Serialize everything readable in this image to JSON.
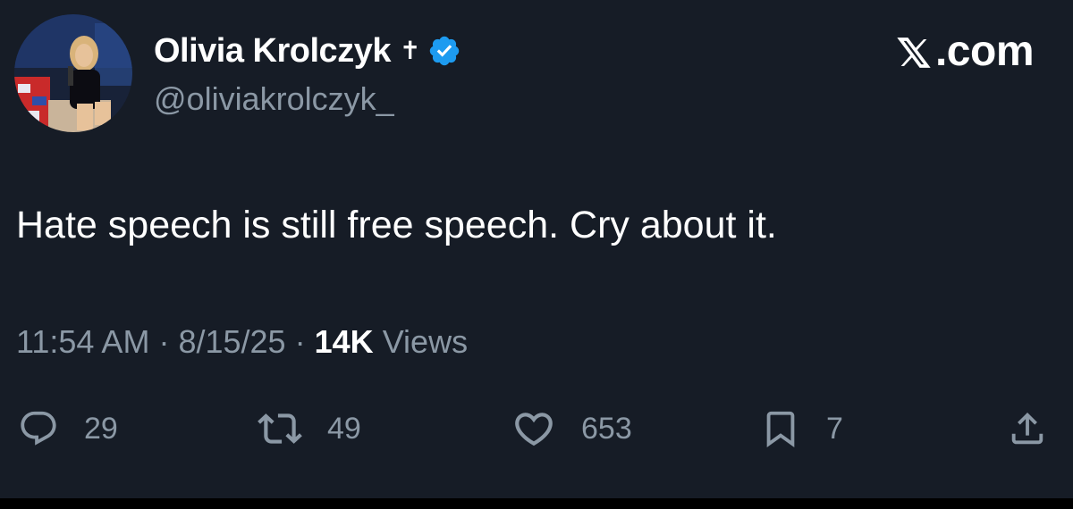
{
  "author": {
    "display_name": "Olivia Krolczyk",
    "name_emoji": "✝",
    "handle": "@oliviakrolczyk_"
  },
  "brand": {
    "label": ".com"
  },
  "tweet": {
    "text": "Hate speech is still free speech. Cry about it.",
    "time": "11:54 AM",
    "date": "8/15/25",
    "separator": "·",
    "views_count": "14K",
    "views_label": "Views"
  },
  "actions": {
    "replies": "29",
    "reposts": "49",
    "likes": "653",
    "bookmarks": "7"
  },
  "colors": {
    "background": "#161c26",
    "verified": "#1d9bf0",
    "secondary_text": "#8b98a5",
    "primary_text": "#ffffff"
  },
  "icons": [
    "verified-badge-icon",
    "x-logo-icon",
    "reply-icon",
    "repost-icon",
    "like-icon",
    "bookmark-icon",
    "share-icon"
  ]
}
